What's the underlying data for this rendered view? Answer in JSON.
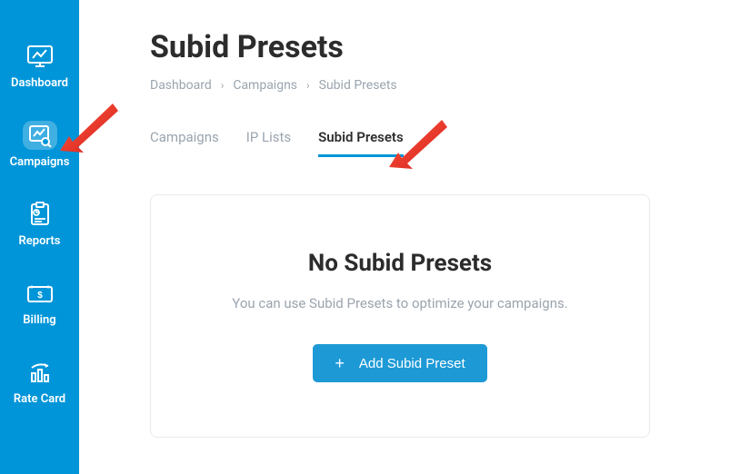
{
  "sidebar": {
    "items": [
      {
        "label": "Dashboard"
      },
      {
        "label": "Campaigns"
      },
      {
        "label": "Reports"
      },
      {
        "label": "Billing"
      },
      {
        "label": "Rate Card"
      }
    ]
  },
  "page": {
    "title": "Subid Presets"
  },
  "breadcrumb": {
    "items": [
      "Dashboard",
      "Campaigns",
      "Subid Presets"
    ]
  },
  "tabs": {
    "items": [
      {
        "label": "Campaigns"
      },
      {
        "label": "IP Lists"
      },
      {
        "label": "Subid Presets"
      }
    ]
  },
  "empty": {
    "title": "No Subid Presets",
    "description": "You can use Subid Presets to optimize your campaigns.",
    "button_label": "Add Subid Preset"
  }
}
